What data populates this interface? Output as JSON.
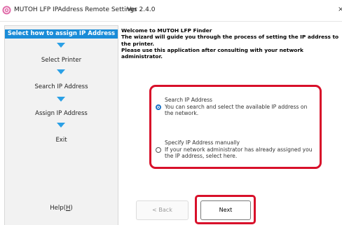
{
  "window": {
    "title": "MUTOH LFP IPAddress Remote Settings",
    "version": "Ver 2.4.0",
    "close_glyph": "×",
    "app_icon": "mutoh-logo-icon"
  },
  "sidebar": {
    "steps": [
      {
        "label": "Select how to assign IP Address",
        "active": true
      },
      {
        "label": "Select Printer",
        "active": false
      },
      {
        "label": "Search IP Address",
        "active": false
      },
      {
        "label": "Assign IP Address",
        "active": false
      },
      {
        "label": "Exit",
        "active": false
      }
    ],
    "step_arrow_icon": "down-arrow-icon",
    "accent_color": "#1a8cd8",
    "help_label": "Help(",
    "help_key": "H",
    "help_close": ")"
  },
  "welcome": {
    "line1": "Welcome to MUTOH LFP Finder",
    "line2": "The wizard will guide you through the process of  setting the IP address to the printer.",
    "line3": "Please use this application after consulting with your network administrator."
  },
  "options": {
    "search": {
      "title": "Search IP Address",
      "description": "You can search and select the available IP address on the network.",
      "selected": true
    },
    "manual": {
      "title": "Specify IP Address manually",
      "description": "If your network administrator has already assigned you the IP address, select here.",
      "selected": false
    },
    "highlight_color": "#d8102a"
  },
  "buttons": {
    "back": "< Back",
    "next": "Next"
  }
}
